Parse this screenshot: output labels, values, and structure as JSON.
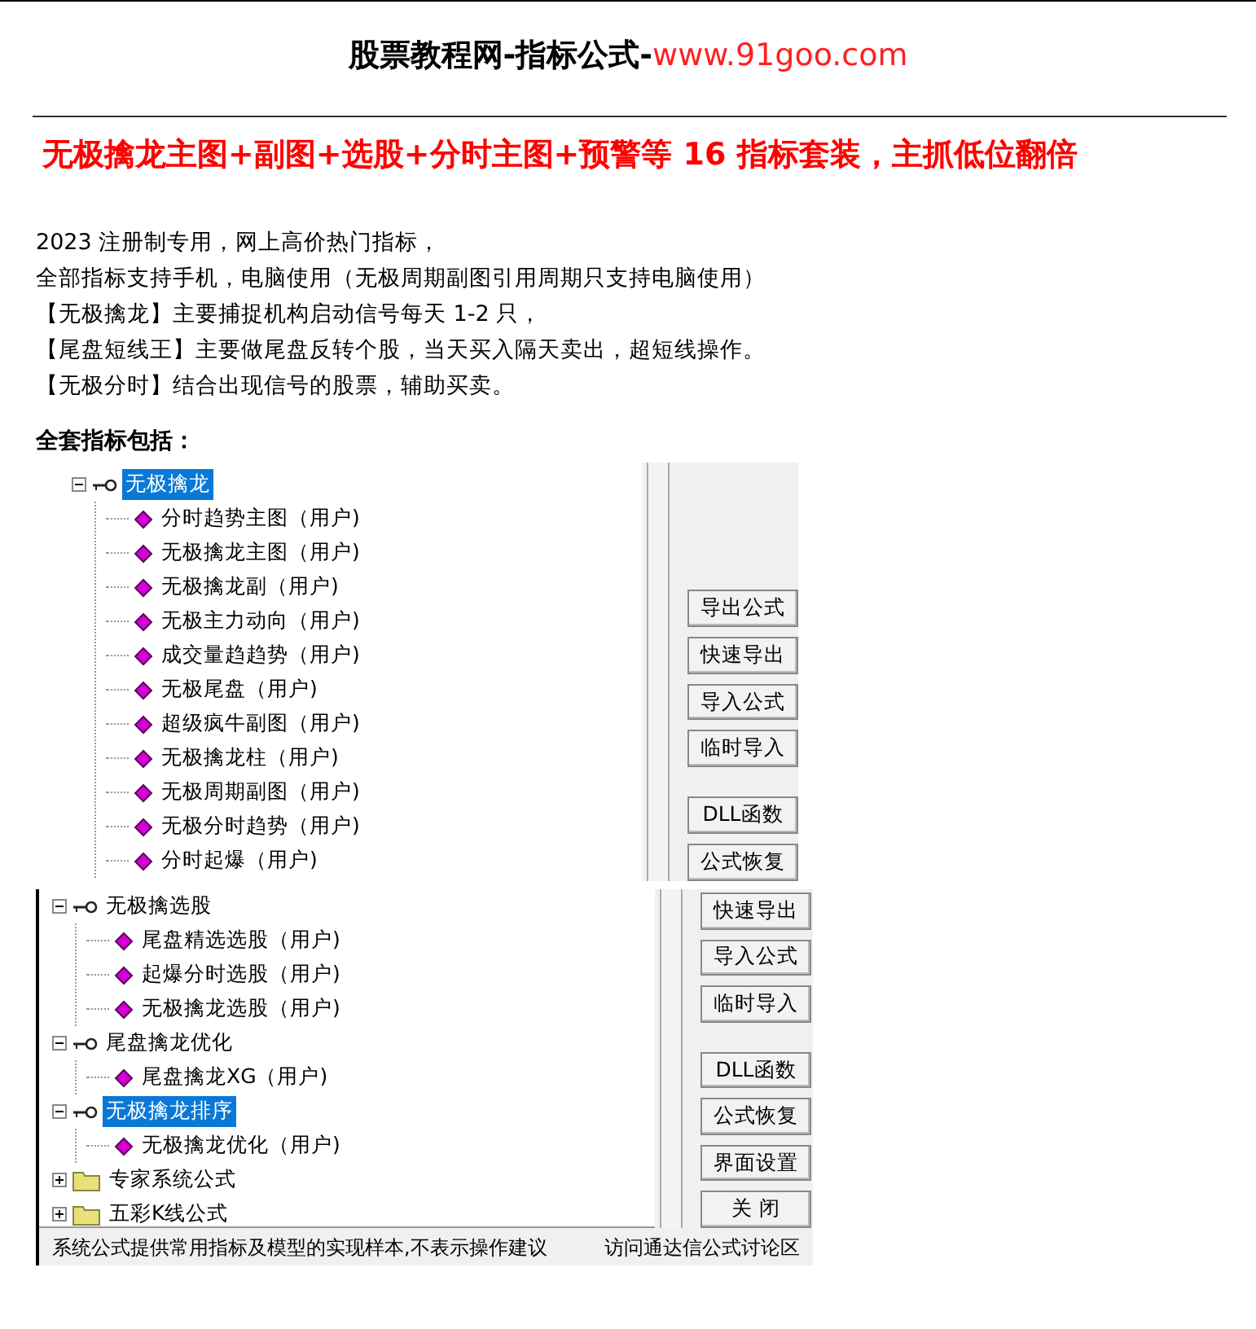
{
  "header": {
    "title": "股票教程网-指标公式-",
    "site": "www.91goo.com"
  },
  "headline": "无极擒龙主图+副图+选股+分时主图+预警等 16 指标套装，主抓低位翻倍",
  "intro": [
    "2023 注册制专用，网上高价热门指标，",
    "全部指标支持手机，电脑使用（无极周期副图引用周期只支持电脑使用）",
    "【无极擒龙】主要捕捉机构启动信号每天 1-2 只，",
    "【尾盘短线王】主要做尾盘反转个股，当天买入隔天卖出，超短线操作。",
    "【无极分时】结合出现信号的股票，辅助买卖。"
  ],
  "section_heading": "全套指标包括：",
  "panels": [
    {
      "tree": [
        {
          "kind": "group",
          "label": "无极擒龙",
          "selected": true,
          "expanded": true,
          "children": [
            {
              "kind": "formula",
              "label": "分时趋势主图（用户)"
            },
            {
              "kind": "formula",
              "label": "无极擒龙主图（用户)"
            },
            {
              "kind": "formula",
              "label": "无极擒龙副（用户)"
            },
            {
              "kind": "formula",
              "label": "无极主力动向（用户)"
            },
            {
              "kind": "formula",
              "label": "成交量趋趋势（用户)"
            },
            {
              "kind": "formula",
              "label": "无极尾盘（用户)"
            },
            {
              "kind": "formula",
              "label": "超级疯牛副图（用户)"
            },
            {
              "kind": "formula",
              "label": "无极擒龙柱（用户)"
            },
            {
              "kind": "formula",
              "label": "无极周期副图（用户)"
            },
            {
              "kind": "formula",
              "label": "无极分时趋势（用户)"
            },
            {
              "kind": "formula",
              "label": "分时起爆（用户)"
            }
          ]
        }
      ],
      "buttons": [
        "导出公式",
        "快速导出",
        "导入公式",
        "临时导入",
        "DLL函数",
        "公式恢复"
      ]
    },
    {
      "tree": [
        {
          "kind": "group",
          "label": "无极擒选股",
          "selected": false,
          "expanded": true,
          "children": [
            {
              "kind": "formula",
              "label": "尾盘精选选股（用户)"
            },
            {
              "kind": "formula",
              "label": "起爆分时选股（用户)"
            },
            {
              "kind": "formula",
              "label": "无极擒龙选股（用户)"
            }
          ]
        },
        {
          "kind": "group",
          "label": "尾盘擒龙优化",
          "selected": false,
          "expanded": true,
          "children": [
            {
              "kind": "formula",
              "label": "尾盘擒龙XG（用户)"
            }
          ]
        },
        {
          "kind": "group",
          "label": "无极擒龙排序",
          "selected": true,
          "expanded": true,
          "children": [
            {
              "kind": "formula",
              "label": "无极擒龙优化（用户)"
            }
          ]
        },
        {
          "kind": "folder",
          "label": "专家系统公式",
          "selected": false,
          "expanded": false
        },
        {
          "kind": "folder",
          "label": "五彩K线公式",
          "selected": false,
          "expanded": false
        }
      ],
      "buttons": [
        "快速导出",
        "导入公式",
        "临时导入",
        "DLL函数",
        "公式恢复",
        "界面设置",
        "关 闭"
      ],
      "status": [
        "系统公式提供常用指标及模型的实现样本,不表示操作建议",
        "访问通达信公式讨论区"
      ]
    }
  ]
}
